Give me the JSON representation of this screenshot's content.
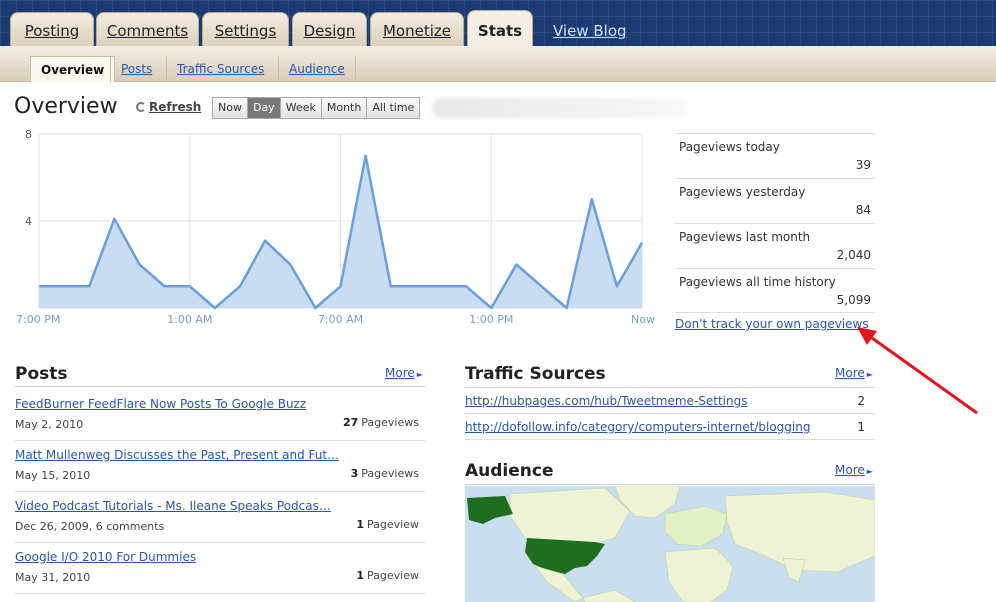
{
  "nav": {
    "tabs": [
      {
        "label": "Posting"
      },
      {
        "label": "Comments"
      },
      {
        "label": "Settings"
      },
      {
        "label": "Design"
      },
      {
        "label": "Monetize"
      },
      {
        "label": "Stats"
      }
    ],
    "active_tab": "Stats",
    "view_blog": "View Blog"
  },
  "subnav": {
    "items": [
      {
        "label": "Overview"
      },
      {
        "label": "Posts"
      },
      {
        "label": "Traffic Sources"
      },
      {
        "label": "Audience"
      }
    ],
    "active": "Overview"
  },
  "overview": {
    "title": "Overview",
    "refresh": "Refresh",
    "ranges": [
      "Now",
      "Day",
      "Week",
      "Month",
      "All time"
    ],
    "active_range": "Day"
  },
  "chart_data": {
    "type": "area",
    "title": "",
    "xlabel": "",
    "ylabel": "",
    "ylim": [
      0,
      8
    ],
    "yticks": [
      4,
      8
    ],
    "xtick_labels": [
      "7:00 PM",
      "1:00 AM",
      "7:00 AM",
      "1:00 PM",
      "Now"
    ],
    "grid": true,
    "series": [
      {
        "values": [
          1,
          1,
          1,
          4.1,
          2,
          1,
          1,
          0,
          1,
          3.1,
          2,
          0,
          1,
          7,
          1,
          1,
          1,
          1,
          0,
          2,
          1,
          0,
          5,
          1,
          3
        ]
      }
    ],
    "colors": {
      "line": "#6a9fd8",
      "fill": "#c9dcf2"
    }
  },
  "stats": [
    {
      "label": "Pageviews today",
      "value": "39"
    },
    {
      "label": "Pageviews yesterday",
      "value": "84"
    },
    {
      "label": "Pageviews last month",
      "value": "2,040"
    },
    {
      "label": "Pageviews all time history",
      "value": "5,099"
    }
  ],
  "dont_track": "Don't track your own pageviews",
  "posts": {
    "title": "Posts",
    "more": "More",
    "items": [
      {
        "title": "FeedBurner FeedFlare Now Posts To Google Buzz",
        "meta": "May 2, 2010",
        "count": "27",
        "unit": "Pageviews"
      },
      {
        "title": "Matt Mullenweg Discusses the Past, Present and Fut…",
        "meta": "May 15, 2010",
        "count": "3",
        "unit": "Pageviews"
      },
      {
        "title": "Video Podcast Tutorials - Ms. Ileane Speaks Podcas…",
        "meta": "Dec 26, 2009, 6 comments",
        "count": "1",
        "unit": "Pageview"
      },
      {
        "title": "Google I/O 2010 For Dummies",
        "meta": "May 31, 2010",
        "count": "1",
        "unit": "Pageview"
      }
    ]
  },
  "traffic": {
    "title": "Traffic Sources",
    "more": "More",
    "items": [
      {
        "url": "http://hubpages.com/hub/Tweetmeme-Settings",
        "count": "2"
      },
      {
        "url": "http://dofollow.info/category/computers-internet/blogging",
        "count": "1"
      }
    ]
  },
  "audience": {
    "title": "Audience",
    "more": "More"
  },
  "colors": {
    "nav_bg": "#1c3b73",
    "link": "#2a56a8",
    "annotation_arrow": "#e0141e",
    "map_highlight": "#1f6e1f",
    "map_land": "#eef3d6"
  }
}
